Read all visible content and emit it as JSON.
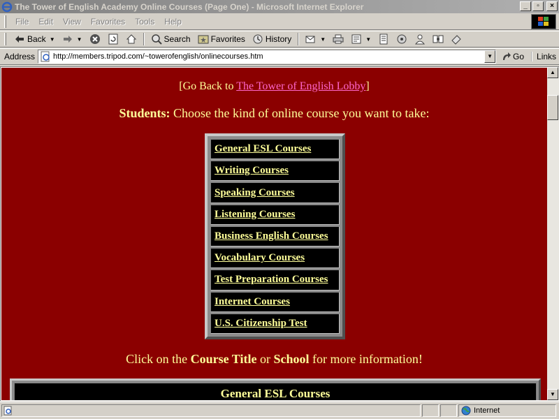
{
  "window": {
    "title": "The Tower of English Academy Online Courses (Page One) - Microsoft Internet Explorer",
    "min_glyph": "_",
    "max_glyph": "▫",
    "close_glyph": "×"
  },
  "menu": {
    "items": [
      "File",
      "Edit",
      "View",
      "Favorites",
      "Tools",
      "Help"
    ]
  },
  "toolbar": {
    "back_label": "Back",
    "search_label": "Search",
    "favorites_label": "Favorites",
    "history_label": "History"
  },
  "address": {
    "label": "Address",
    "url": "http://members.tripod.com/~towerofenglish/onlinecourses.htm",
    "go_label": "Go",
    "links_label": "Links"
  },
  "page": {
    "goback_prefix": "[Go Back to ",
    "goback_link": "The Tower of English Lobby",
    "goback_suffix": "]",
    "students_bold": "Students:",
    "students_text": " Choose the kind of online course you want to take:",
    "courses": [
      "General ESL Courses",
      "Writing Courses",
      "Speaking Courses",
      "Listening Courses",
      "Business English Courses",
      "Vocabulary Courses",
      "Test Preparation Courses",
      "Internet Courses",
      "U.S. Citizenship Test"
    ],
    "click_prefix": "Click on the ",
    "click_bold1": "Course Title",
    "click_mid": " or ",
    "click_bold2": "School",
    "click_suffix": " for more information!",
    "section_heading": "General ESL Courses"
  },
  "status": {
    "zone": "Internet"
  },
  "colors": {
    "page_bg": "#8b0000",
    "text": "#ffff99",
    "link": "#ff66cc"
  }
}
